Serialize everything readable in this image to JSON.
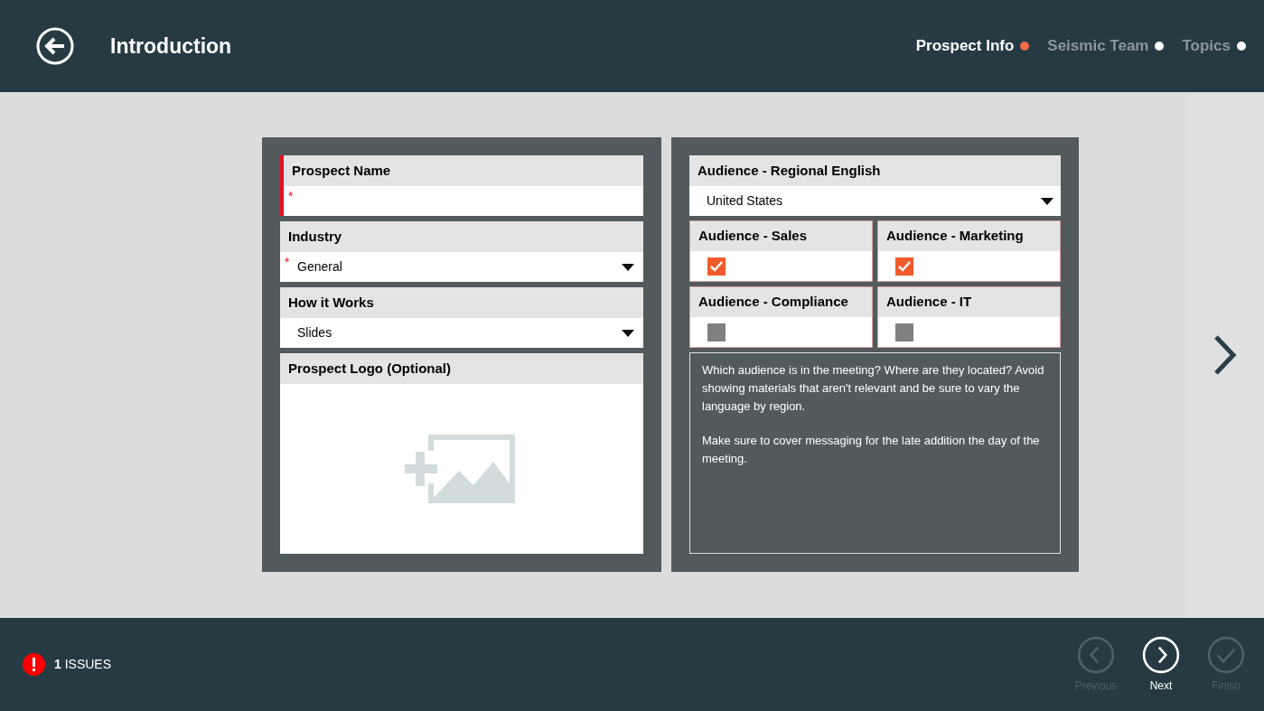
{
  "header": {
    "title": "Introduction",
    "steps": [
      {
        "label": "Prospect Info",
        "selected": true
      },
      {
        "label": "Seismic Team",
        "selected": false
      },
      {
        "label": "Topics",
        "selected": false
      }
    ]
  },
  "left_fields": [
    {
      "kind": "text",
      "label": "Prospect Name",
      "required_mark": "*",
      "invalid": true
    },
    {
      "kind": "dropdown",
      "label": "Industry",
      "value": "General",
      "required_mark": "*",
      "invalid": false
    },
    {
      "kind": "dropdown",
      "label": "How it Works",
      "value": "Slides",
      "invalid": false
    },
    {
      "kind": "image",
      "label": "Prospect Logo (Optional)",
      "invalid": false
    }
  ],
  "regional": {
    "label": "Audience - Regional English",
    "value": "United States"
  },
  "audiences": [
    {
      "label": "Audience - Sales",
      "checked": true
    },
    {
      "label": "Audience - Marketing",
      "checked": true
    },
    {
      "label": "Audience - Compliance",
      "checked": false
    },
    {
      "label": "Audience - IT",
      "checked": false
    }
  ],
  "notes": [
    "Which audience is in the meeting? Where are they located? Avoid showing materials that aren't relevant and be sure to vary the language by region.",
    "Make sure to cover messaging for the late addition the day of the meeting."
  ],
  "footer": {
    "issues": "**1** ISSUES",
    "buttons": [
      {
        "kind": "previous",
        "label": "Previous",
        "disabled": true
      },
      {
        "kind": "next",
        "label": "Next",
        "disabled": false
      },
      {
        "kind": "finish",
        "label": "Finish",
        "disabled": true
      }
    ]
  }
}
